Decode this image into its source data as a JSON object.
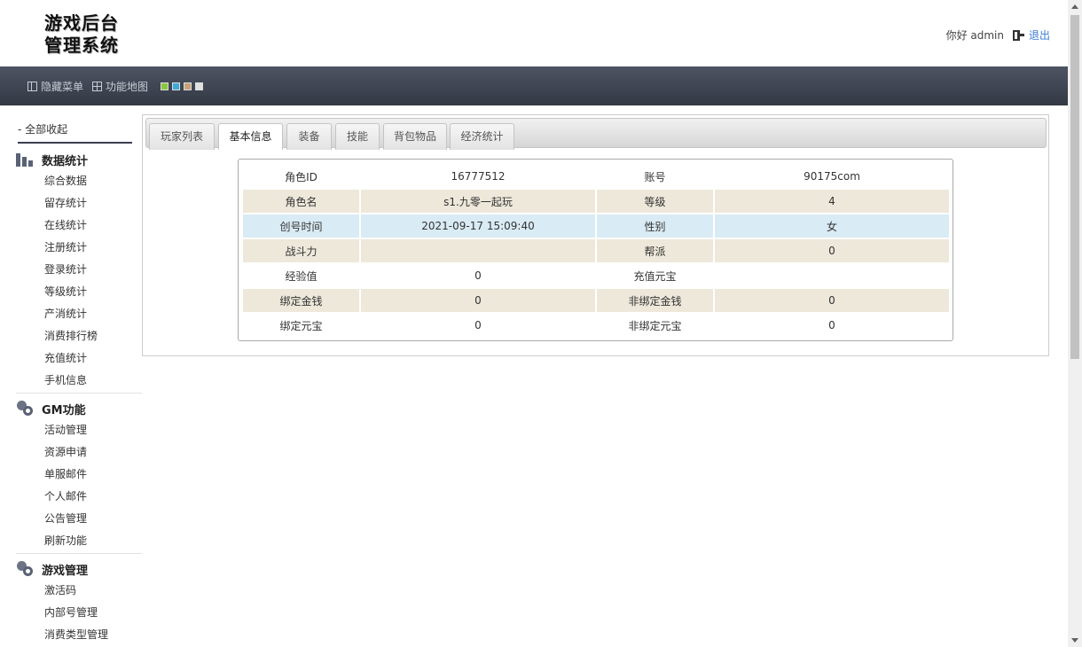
{
  "header": {
    "logo_line1": "游戏后台",
    "logo_line2": "管理系统",
    "greeting": "你好 admin",
    "logout": "退出"
  },
  "toolbar": {
    "hide_menu": "隐藏菜单",
    "function_map": "功能地图",
    "theme_colors": [
      "#8cc63f",
      "#3fa9d8",
      "#c8a27a",
      "#e0e0e0"
    ]
  },
  "sidebar": {
    "collapse_all": "- 全部收起",
    "groups": [
      {
        "title": "数据统计",
        "icon": "bar-chart-icon",
        "items": [
          "综合数据",
          "留存统计",
          "在线统计",
          "注册统计",
          "登录统计",
          "等级统计",
          "产消统计",
          "消费排行榜",
          "充值统计",
          "手机信息"
        ]
      },
      {
        "title": "GM功能",
        "icon": "gear-icon",
        "items": [
          "活动管理",
          "资源申请",
          "单服邮件",
          "个人邮件",
          "公告管理",
          "刷新功能"
        ]
      },
      {
        "title": "游戏管理",
        "icon": "gear-icon",
        "items": [
          "激活码",
          "内部号管理",
          "消费类型管理"
        ]
      }
    ]
  },
  "tabs": [
    "玩家列表",
    "基本信息",
    "装备",
    "技能",
    "背包物品",
    "经济统计"
  ],
  "active_tab": "基本信息",
  "info": {
    "rows": [
      [
        "角色ID",
        "16777512",
        "账号",
        "90175com"
      ],
      [
        "角色名",
        "s1.九零一起玩",
        "等级",
        "4"
      ],
      [
        "创号时间",
        "2021-09-17 15:09:40",
        "性别",
        "女"
      ],
      [
        "战斗力",
        "",
        "帮派",
        "0"
      ],
      [
        "经验值",
        "0",
        "充值元宝",
        ""
      ],
      [
        "绑定金钱",
        "0",
        "非绑定金钱",
        "0"
      ],
      [
        "绑定元宝",
        "0",
        "非绑定元宝",
        "0"
      ]
    ],
    "row_colors": {
      "beige": "#ede8da",
      "blue": "#d9ebf4",
      "white": "#ffffff"
    }
  }
}
